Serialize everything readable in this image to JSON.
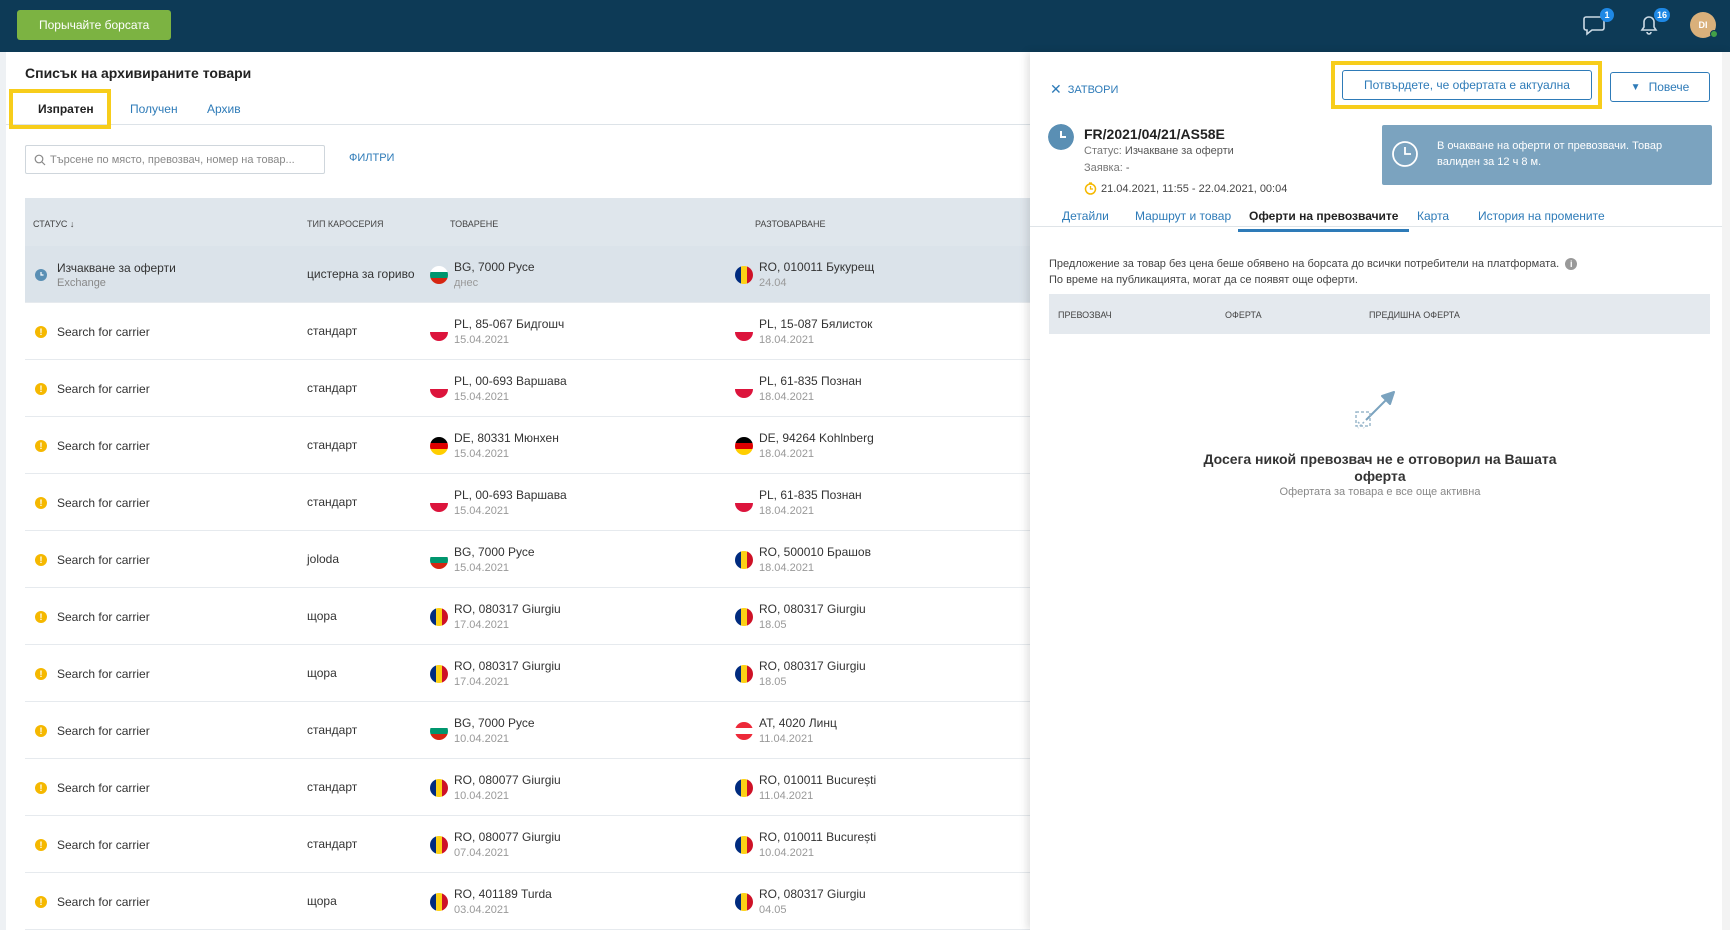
{
  "topbar": {
    "exchange_button": "Порычайте борсата",
    "messages_badge": "1",
    "notifications_badge": "16",
    "avatar_initials": "DI"
  },
  "list": {
    "title": "Списък на архивираните товари",
    "tabs": [
      "Изпратен",
      "Получен",
      "Архив"
    ],
    "search_placeholder": "Търсене по място, превозвач, номер на товар...",
    "filters_label": "ФИЛТРИ",
    "columns": [
      "СТАТУС ↓",
      "ТИП КАРОСЕРИЯ",
      "ТОВАРЕНЕ",
      "РАЗТОВАРВАНЕ"
    ],
    "rows": [
      {
        "status": "Изчакване за оферти",
        "status_sub": "Exchange",
        "status_type": "clock",
        "body": "цистерна за гориво",
        "load_flag": "BG",
        "load": "BG, 7000 Русе",
        "load_date": "днес",
        "unload_flag": "RO",
        "unload": "RO, 010011 Букурещ",
        "unload_date": "24.04"
      },
      {
        "status": "Search for carrier",
        "status_sub": "",
        "status_type": "warn",
        "body": "стандарт",
        "load_flag": "PL",
        "load": "PL, 85-067 Бидгошч",
        "load_date": "15.04.2021",
        "unload_flag": "PL",
        "unload": "PL, 15-087 Бялисток",
        "unload_date": "18.04.2021"
      },
      {
        "status": "Search for carrier",
        "status_sub": "",
        "status_type": "warn",
        "body": "стандарт",
        "load_flag": "PL",
        "load": "PL, 00-693 Варшава",
        "load_date": "15.04.2021",
        "unload_flag": "PL",
        "unload": "PL, 61-835 Познан",
        "unload_date": "18.04.2021"
      },
      {
        "status": "Search for carrier",
        "status_sub": "",
        "status_type": "warn",
        "body": "стандарт",
        "load_flag": "DE",
        "load": "DE, 80331 Мюнхен",
        "load_date": "15.04.2021",
        "unload_flag": "DE",
        "unload": "DE, 94264 Kohlnberg",
        "unload_date": "18.04.2021"
      },
      {
        "status": "Search for carrier",
        "status_sub": "",
        "status_type": "warn",
        "body": "стандарт",
        "load_flag": "PL",
        "load": "PL, 00-693 Варшава",
        "load_date": "15.04.2021",
        "unload_flag": "PL",
        "unload": "PL, 61-835 Познан",
        "unload_date": "18.04.2021"
      },
      {
        "status": "Search for carrier",
        "status_sub": "",
        "status_type": "warn",
        "body": "joloda",
        "load_flag": "BG",
        "load": "BG, 7000 Русе",
        "load_date": "15.04.2021",
        "unload_flag": "RO",
        "unload": "RO, 500010 Брашов",
        "unload_date": "18.04.2021"
      },
      {
        "status": "Search for carrier",
        "status_sub": "",
        "status_type": "warn",
        "body": "щора",
        "load_flag": "RO",
        "load": "RO, 080317 Giurgiu",
        "load_date": "17.04.2021",
        "unload_flag": "RO",
        "unload": "RO, 080317 Giurgiu",
        "unload_date": "18.05"
      },
      {
        "status": "Search for carrier",
        "status_sub": "",
        "status_type": "warn",
        "body": "щора",
        "load_flag": "RO",
        "load": "RO, 080317 Giurgiu",
        "load_date": "17.04.2021",
        "unload_flag": "RO",
        "unload": "RO, 080317 Giurgiu",
        "unload_date": "18.05"
      },
      {
        "status": "Search for carrier",
        "status_sub": "",
        "status_type": "warn",
        "body": "стандарт",
        "load_flag": "BG",
        "load": "BG, 7000 Русе",
        "load_date": "10.04.2021",
        "unload_flag": "AT",
        "unload": "AT, 4020 Линц",
        "unload_date": "11.04.2021"
      },
      {
        "status": "Search for carrier",
        "status_sub": "",
        "status_type": "warn",
        "body": "стандарт",
        "load_flag": "RO",
        "load": "RO, 080077 Giurgiu",
        "load_date": "10.04.2021",
        "unload_flag": "RO",
        "unload": "RO, 010011 București",
        "unload_date": "11.04.2021"
      },
      {
        "status": "Search for carrier",
        "status_sub": "",
        "status_type": "warn",
        "body": "стандарт",
        "load_flag": "RO",
        "load": "RO, 080077 Giurgiu",
        "load_date": "07.04.2021",
        "unload_flag": "RO",
        "unload": "RO, 010011 București",
        "unload_date": "10.04.2021"
      },
      {
        "status": "Search for carrier",
        "status_sub": "",
        "status_type": "warn",
        "body": "щора",
        "load_flag": "RO",
        "load": "RO, 401189 Turda",
        "load_date": "03.04.2021",
        "unload_flag": "RO",
        "unload": "RO, 080317 Giurgiu",
        "unload_date": "04.05"
      }
    ]
  },
  "panel": {
    "close_label": "ЗАТВОРИ",
    "confirm_button": "Потвърдете, че офертата е актуална",
    "more_button": "Повече",
    "reference": "FR/2021/04/21/AS58E",
    "status_label": "Статус:",
    "status_value": "Изчакване за оферти",
    "request_label": "Заявка:",
    "request_value": "-",
    "validity": "21.04.2021, 11:55 - 22.04.2021, 00:04",
    "info_text": "В очакване на оферти от превозвачи. Товар валиден за 12 ч 8 м.",
    "tabs": [
      "Детайли",
      "Маршрут и товар",
      "Оферти на превозвачите",
      "Карта",
      "История на промените"
    ],
    "intro_line1": "Предложение за товар без цена беше обявено на борсата до всички потребители на платформата.",
    "intro_line2": "По време на публикацията, могат да се появят още оферти.",
    "offer_columns": [
      "ПРЕВОЗВАЧ",
      "ОФЕРТА",
      "ПРЕДИШНА ОФЕРТА"
    ],
    "empty_title": "Досега никой превозвач не е отговорил на Вашата оферта",
    "empty_sub": "Офертата за товара е все още активна"
  },
  "colors": {
    "topbar": "#0d3a56",
    "accent": "#2e7bb8",
    "highlight": "#f7cd1b",
    "green": "#7cb342",
    "warning": "#f5b800"
  }
}
